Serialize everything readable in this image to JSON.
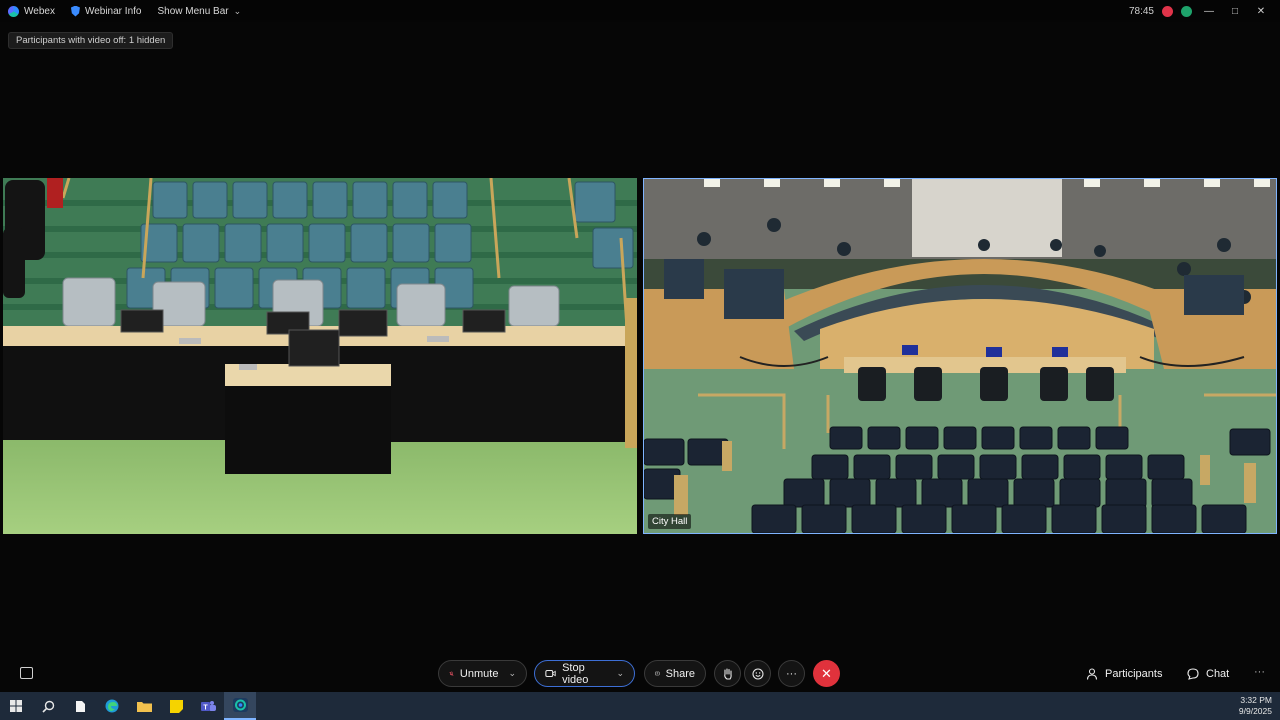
{
  "topbar": {
    "app_label": "Webex",
    "webinar_info_label": "Webinar Info",
    "show_menu_label": "Show Menu Bar",
    "timer": "78:45"
  },
  "hidden_participants": "Participants with video off: 1 hidden",
  "tiles": {
    "right_name": "City Hall"
  },
  "controls": {
    "unmute_label": "Unmute",
    "stop_video_label": "Stop video",
    "share_label": "Share",
    "participants_label": "Participants",
    "chat_label": "Chat"
  },
  "taskbar": {
    "time": "3:32 PM",
    "date": "9/9/2025"
  },
  "colors": {
    "end_call": "#e0323c",
    "active_outline": "#3d6fd6",
    "speaker_border": "#7fb4ff"
  }
}
